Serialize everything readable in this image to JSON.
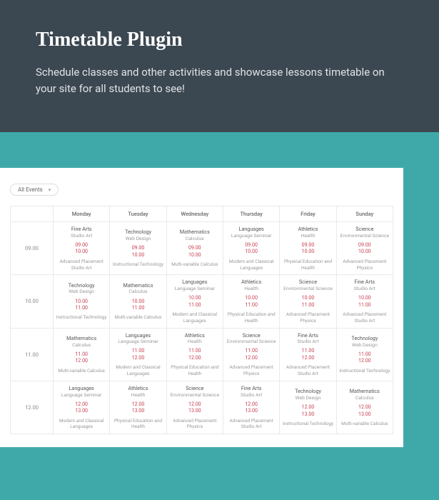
{
  "hero": {
    "title": "Timetable Plugin",
    "subtitle": "Schedule classes and other activities and showcase lessons timetable on your site for all students to see!"
  },
  "filter": {
    "label": "All Events"
  },
  "days": [
    "Monday",
    "Tuesday",
    "Wednesday",
    "Thursday",
    "Friday",
    "Sunday"
  ],
  "rows": [
    {
      "time": "09.00",
      "cells": [
        {
          "subj": "Fine Arts",
          "course": "Studio Art",
          "start": "09.00",
          "end": "10.00",
          "adv": "Advanced Placement Studio Art"
        },
        {
          "subj": "Technology",
          "course": "Web Design",
          "start": "09.00",
          "end": "10.00",
          "adv": "Instructional Technology"
        },
        {
          "subj": "Mathematics",
          "course": "Calculus",
          "start": "09.00",
          "end": "10.00",
          "adv": "Multi-variable Calculus"
        },
        {
          "subj": "Languages",
          "course": "Language Seminar",
          "start": "09.00",
          "end": "10.00",
          "adv": "Modern and Classical Languages"
        },
        {
          "subj": "Athletics",
          "course": "Health",
          "start": "09.00",
          "end": "10.00",
          "adv": "Physical Education and Health"
        },
        {
          "subj": "Science",
          "course": "Environmental Science",
          "start": "09.00",
          "end": "10.00",
          "adv": "Advanced Placement Physics"
        }
      ]
    },
    {
      "time": "10.00",
      "cells": [
        {
          "subj": "Technology",
          "course": "Web Design",
          "start": "10.00",
          "end": "11.00",
          "adv": "Instructional Technology"
        },
        {
          "subj": "Mathematics",
          "course": "Calculus",
          "start": "10.00",
          "end": "11.00",
          "adv": "Multi-variable Calculus"
        },
        {
          "subj": "Languages",
          "course": "Language Seminar",
          "start": "10.00",
          "end": "11.00",
          "adv": "Modern and Classical Languages"
        },
        {
          "subj": "Athletics",
          "course": "Health",
          "start": "10.00",
          "end": "11.00",
          "adv": "Physical Education and Health"
        },
        {
          "subj": "Science",
          "course": "Environmental Science",
          "start": "10.00",
          "end": "11.00",
          "adv": "Advanced Placement Physics"
        },
        {
          "subj": "Fine Arts",
          "course": "Studio Art",
          "start": "10.00",
          "end": "11.00",
          "adv": "Advanced Placement Studio Art"
        }
      ]
    },
    {
      "time": "11.00",
      "cells": [
        {
          "subj": "Mathematics",
          "course": "Calculus",
          "start": "11.00",
          "end": "12.00",
          "adv": "Multi-variable Calculus"
        },
        {
          "subj": "Languages",
          "course": "Language Seminar",
          "start": "11.00",
          "end": "12.00",
          "adv": "Modern and Classical Languages"
        },
        {
          "subj": "Athletics",
          "course": "Health",
          "start": "11.00",
          "end": "12.00",
          "adv": "Physical Education and Health"
        },
        {
          "subj": "Science",
          "course": "Environmental Science",
          "start": "11.00",
          "end": "12.00",
          "adv": "Advanced Placement Physics"
        },
        {
          "subj": "Fine Arts",
          "course": "Studio Art",
          "start": "11.00",
          "end": "12.00",
          "adv": "Advanced Placement Studio Art"
        },
        {
          "subj": "Technology",
          "course": "Web Design",
          "start": "11.00",
          "end": "12.00",
          "adv": "Instructional Technology"
        }
      ]
    },
    {
      "time": "12.00",
      "cells": [
        {
          "subj": "Languages",
          "course": "Language Seminar",
          "start": "12.00",
          "end": "13.00",
          "adv": "Modern and Classical Languages"
        },
        {
          "subj": "Athletics",
          "course": "Health",
          "start": "12.00",
          "end": "13.00",
          "adv": "Physical Education and Health"
        },
        {
          "subj": "Science",
          "course": "Environmental Science",
          "start": "12.00",
          "end": "13.00",
          "adv": "Advanced Placement Physics"
        },
        {
          "subj": "Fine Arts",
          "course": "Studio Art",
          "start": "12.00",
          "end": "13.00",
          "adv": "Advanced Placement Studio Art"
        },
        {
          "subj": "Technology",
          "course": "Web Design",
          "start": "12.00",
          "end": "13.00",
          "adv": "Instructional Technology"
        },
        {
          "subj": "Mathematics",
          "course": "Calculus",
          "start": "12.00",
          "end": "13.00",
          "adv": "Multi-variable Calculus"
        }
      ]
    }
  ]
}
